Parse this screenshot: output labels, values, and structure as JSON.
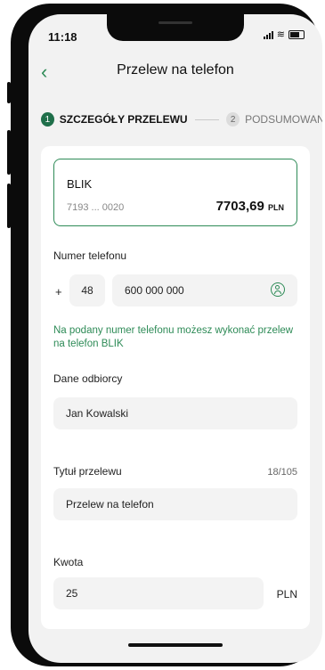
{
  "status_bar": {
    "time": "11:18"
  },
  "header": {
    "back": "‹",
    "title": "Przelew na telefon"
  },
  "steps": [
    {
      "number": "1",
      "label": "SZCZEGÓŁY PRZELEWU"
    },
    {
      "number": "2",
      "label": "PODSUMOWANIE"
    }
  ],
  "account": {
    "name": "BLIK",
    "number": "7193 ... 0020",
    "balance": "7703,69",
    "currency": "PLN"
  },
  "phone": {
    "label": "Numer telefonu",
    "plus": "+",
    "prefix": "48",
    "number": "600 000 000",
    "note": "Na podany numer telefonu możesz wykonać przelew na telefon BLIK"
  },
  "recipient": {
    "label": "Dane odbiorcy",
    "value": "Jan Kowalski"
  },
  "title_field": {
    "label": "Tytuł przelewu",
    "counter": "18/105",
    "value": "Przelew na telefon"
  },
  "amount": {
    "label": "Kwota",
    "value": "25",
    "currency": "PLN"
  },
  "colors": {
    "accent": "#2e8b57",
    "step_active": "#1f6f4a"
  },
  "icons": {
    "back": "chevron-left-icon",
    "contact": "contact-icon"
  }
}
